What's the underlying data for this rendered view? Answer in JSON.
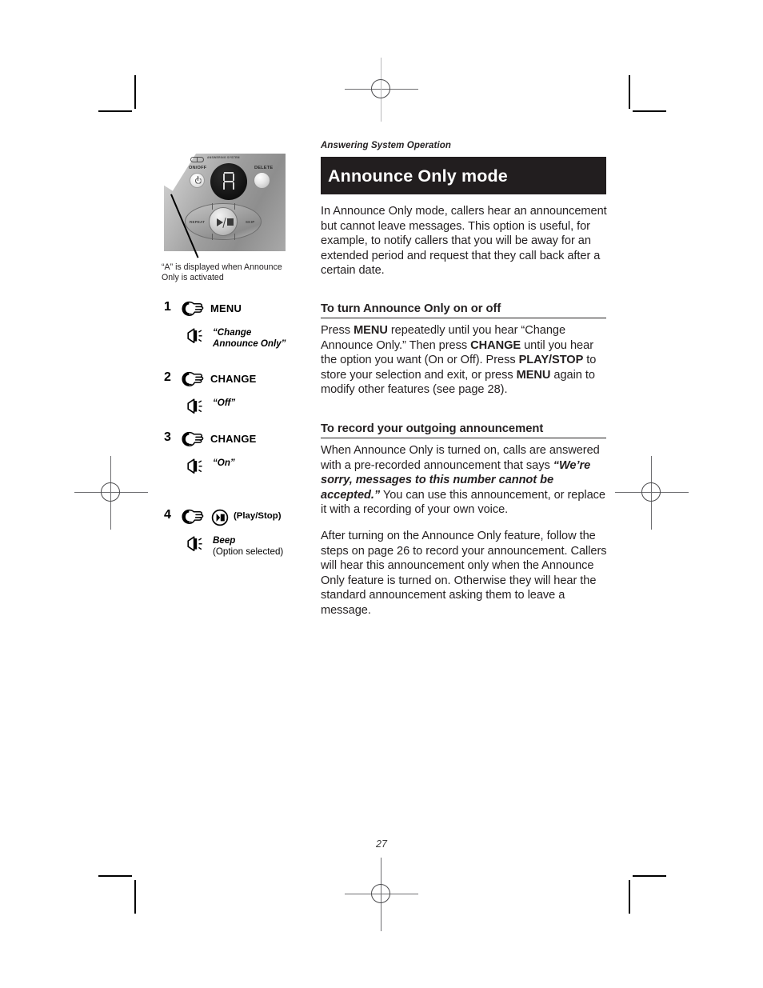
{
  "document": {
    "running_head": "Answering System Operation",
    "page_number": "27"
  },
  "title_band": {
    "title": "Announce Only mode",
    "background": "#221e1f",
    "text_color": "#ffffff"
  },
  "intro": {
    "paragraph": "In Announce Only mode, callers hear an announcement but cannot leave messages. This option is useful, for example, to notify callers that you will be away for an extended period and request that they call back after a certain date."
  },
  "section_on_off": {
    "heading": "To turn Announce Only on or off",
    "paragraph_parts": [
      {
        "text": "Press ",
        "style": "normal"
      },
      {
        "text": "MENU",
        "style": "bold"
      },
      {
        "text": " repeatedly until you hear “Change Announce Only.” Then press ",
        "style": "normal"
      },
      {
        "text": "CHANGE",
        "style": "bold"
      },
      {
        "text": " until you hear the option you want (On or Off). Press ",
        "style": "normal"
      },
      {
        "text": "PLAY/STOP",
        "style": "bold"
      },
      {
        "text": " to store your selection and exit, or press ",
        "style": "normal"
      },
      {
        "text": "MENU",
        "style": "bold"
      },
      {
        "text": " again to modify other features (see page 28).",
        "style": "normal"
      }
    ]
  },
  "section_record": {
    "heading": "To record your outgoing announcement",
    "paragraph1_parts": [
      {
        "text": "When Announce Only is turned on, calls are answered with a pre-recorded announcement  that says ",
        "style": "normal"
      },
      {
        "text": "“We’re sorry, messages to this number cannot be accepted.”",
        "style": "bold-italic"
      },
      {
        "text": " You can use this announcement, or replace it with a recording of your own voice.",
        "style": "normal"
      }
    ],
    "paragraph2": "After turning on the Announce Only feature, follow the steps on page 26 to record your announcement. Callers will hear this announcement only when the Announce Only feature is turned on. Otherwise they will hear the standard announcement asking them to leave a message."
  },
  "figure": {
    "caption": "“A” is displayed when Announce Only is activated",
    "device": {
      "brand_text": "ANSWERING SYSTEM",
      "labels": {
        "on_off": "ON/OFF",
        "delete": "DELETE",
        "repeat": "REPEAT",
        "skip": "SKIP"
      },
      "display_character": "A"
    }
  },
  "steps": [
    {
      "number": "1",
      "hand_icon": "pointing-hand-icon",
      "key_label": "MENU",
      "speaker_icon": "speaker-icon",
      "prompt": "“Change\nAnnounce Only”",
      "prompt_line1": "“Change",
      "prompt_line2": "Announce Only”",
      "prompt_style": "bold-italic"
    },
    {
      "number": "2",
      "hand_icon": "pointing-hand-icon",
      "key_label": "CHANGE",
      "speaker_icon": "speaker-icon",
      "prompt_line1": "“Off”",
      "prompt_line2": "",
      "prompt_style": "bold-italic"
    },
    {
      "number": "3",
      "hand_icon": "pointing-hand-icon",
      "key_label": "CHANGE",
      "speaker_icon": "speaker-icon",
      "prompt_line1": "“On”",
      "prompt_line2": "",
      "prompt_style": "bold-italic"
    },
    {
      "number": "4",
      "hand_icon": "pointing-hand-icon",
      "key_icon": "play-stop-icon",
      "key_label": "(Play/Stop)",
      "speaker_icon": "speaker-icon",
      "prompt_line1": "Beep",
      "prompt_line2": "(Option selected)",
      "prompt_style": "bold-italic"
    }
  ]
}
